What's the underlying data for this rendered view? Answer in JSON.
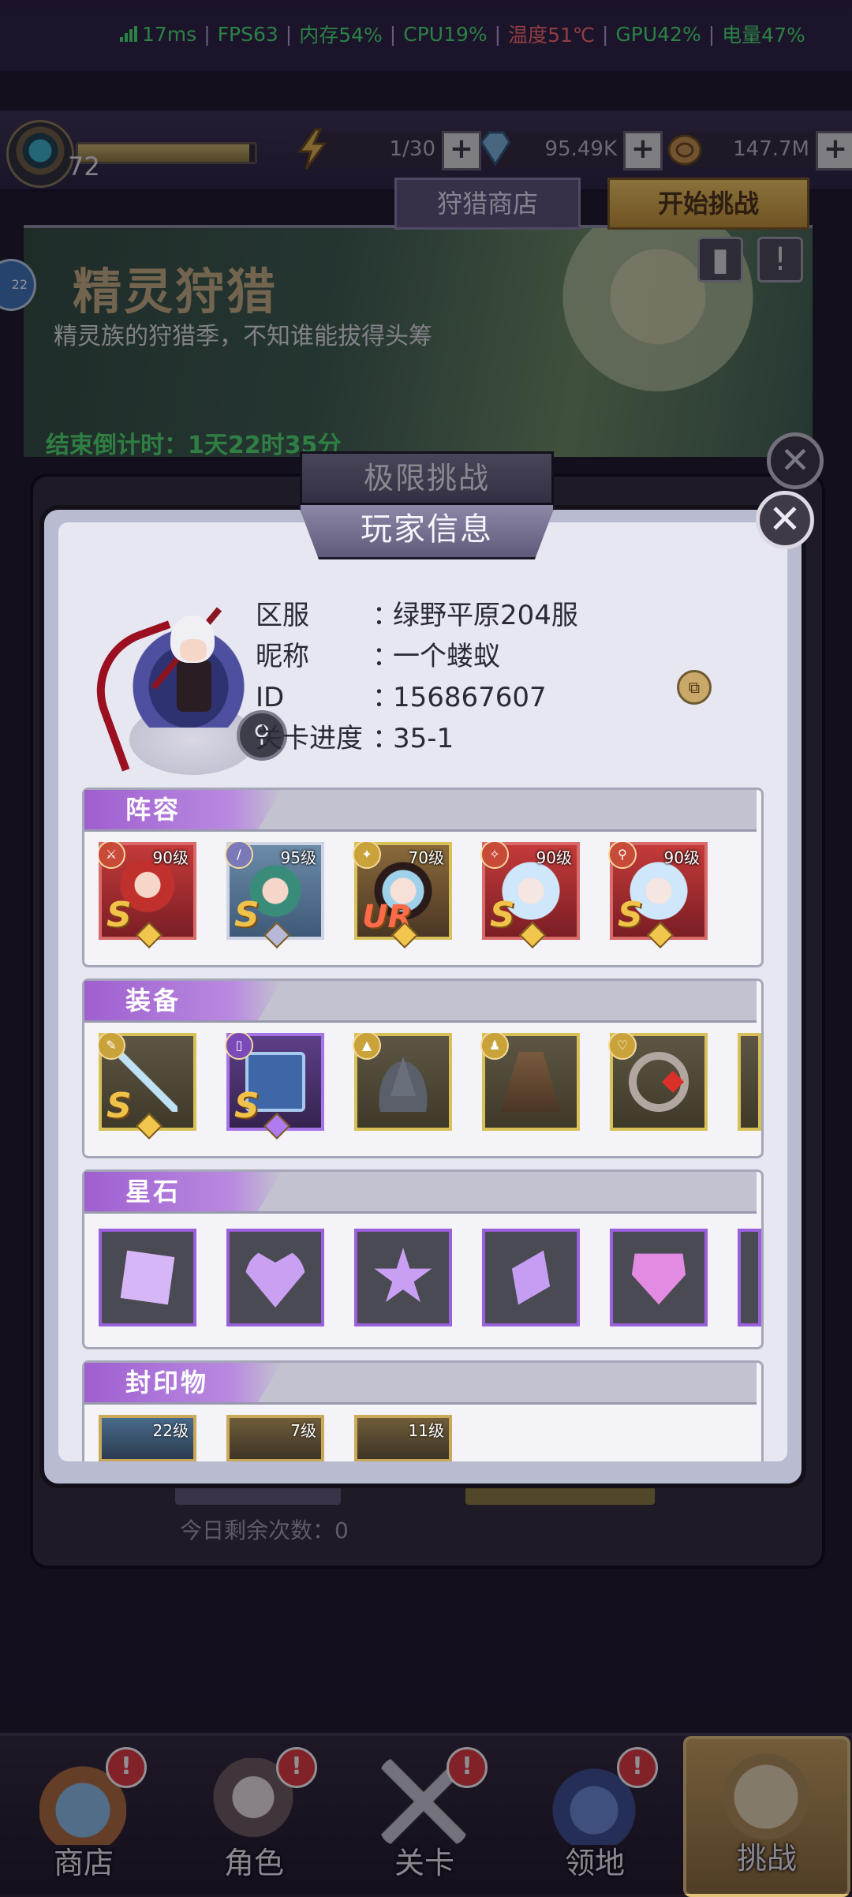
{
  "status_bar": {
    "latency": "17ms",
    "fps": "FPS63",
    "memory": "内存54%",
    "cpu": "CPU19%",
    "temperature": "温度51℃",
    "gpu": "GPU42%",
    "battery": "电量47%"
  },
  "top_bar": {
    "level": "72",
    "xp_fraction": 0.97,
    "energy": "1/30",
    "gems": "95.49K",
    "gold": "147.7M"
  },
  "background": {
    "event_title": "精灵狩猎",
    "event_subtitle": "精灵族的狩猎季，不知谁能拔得头筹",
    "countdown": "结束倒计时：1天22时35分",
    "hunt_shop": "狩猎商店",
    "start_challenge": "开始挑战",
    "dialog_title": "极限挑战",
    "remaining": "今日剩余次数：0",
    "side_badge": "22"
  },
  "player_info": {
    "title": "玩家信息",
    "rows": [
      {
        "key": "区服",
        "value": "绿野平原204服"
      },
      {
        "key": "昵称",
        "value": "一个蝼蚁"
      },
      {
        "key": "ID",
        "value": "156867607"
      },
      {
        "key": "关卡进度",
        "value": "35-1"
      }
    ],
    "colon": "：",
    "copy_label": "⧉"
  },
  "sections": {
    "lineup": {
      "label": "阵容",
      "heroes": [
        {
          "level": "90级",
          "rank": "S"
        },
        {
          "level": "95级",
          "rank": "S"
        },
        {
          "level": "70级",
          "rank": "UR"
        },
        {
          "level": "90级",
          "rank": "S"
        },
        {
          "level": "90级",
          "rank": "S"
        }
      ]
    },
    "equipment": {
      "label": "装备",
      "items": [
        {
          "name": "spear",
          "rank": "S"
        },
        {
          "name": "book",
          "rank": "S"
        },
        {
          "name": "hat",
          "rank": ""
        },
        {
          "name": "cloak",
          "rank": ""
        },
        {
          "name": "ring",
          "rank": ""
        }
      ]
    },
    "star_stones": {
      "label": "星石"
    },
    "seals": {
      "label": "封印物",
      "items": [
        {
          "level": "22级"
        },
        {
          "level": "7级"
        },
        {
          "level": "11级"
        }
      ]
    }
  },
  "nav": [
    {
      "label": "商店",
      "badge": "!"
    },
    {
      "label": "角色",
      "badge": "!"
    },
    {
      "label": "关卡",
      "badge": "!"
    },
    {
      "label": "领地",
      "badge": "!"
    },
    {
      "label": "挑战",
      "badge": ""
    }
  ],
  "colors": {
    "accent_purple": "#9f5fd0",
    "status_green": "#46e56d",
    "status_red": "#ff6a6a",
    "gold_border": "#d8c058"
  }
}
